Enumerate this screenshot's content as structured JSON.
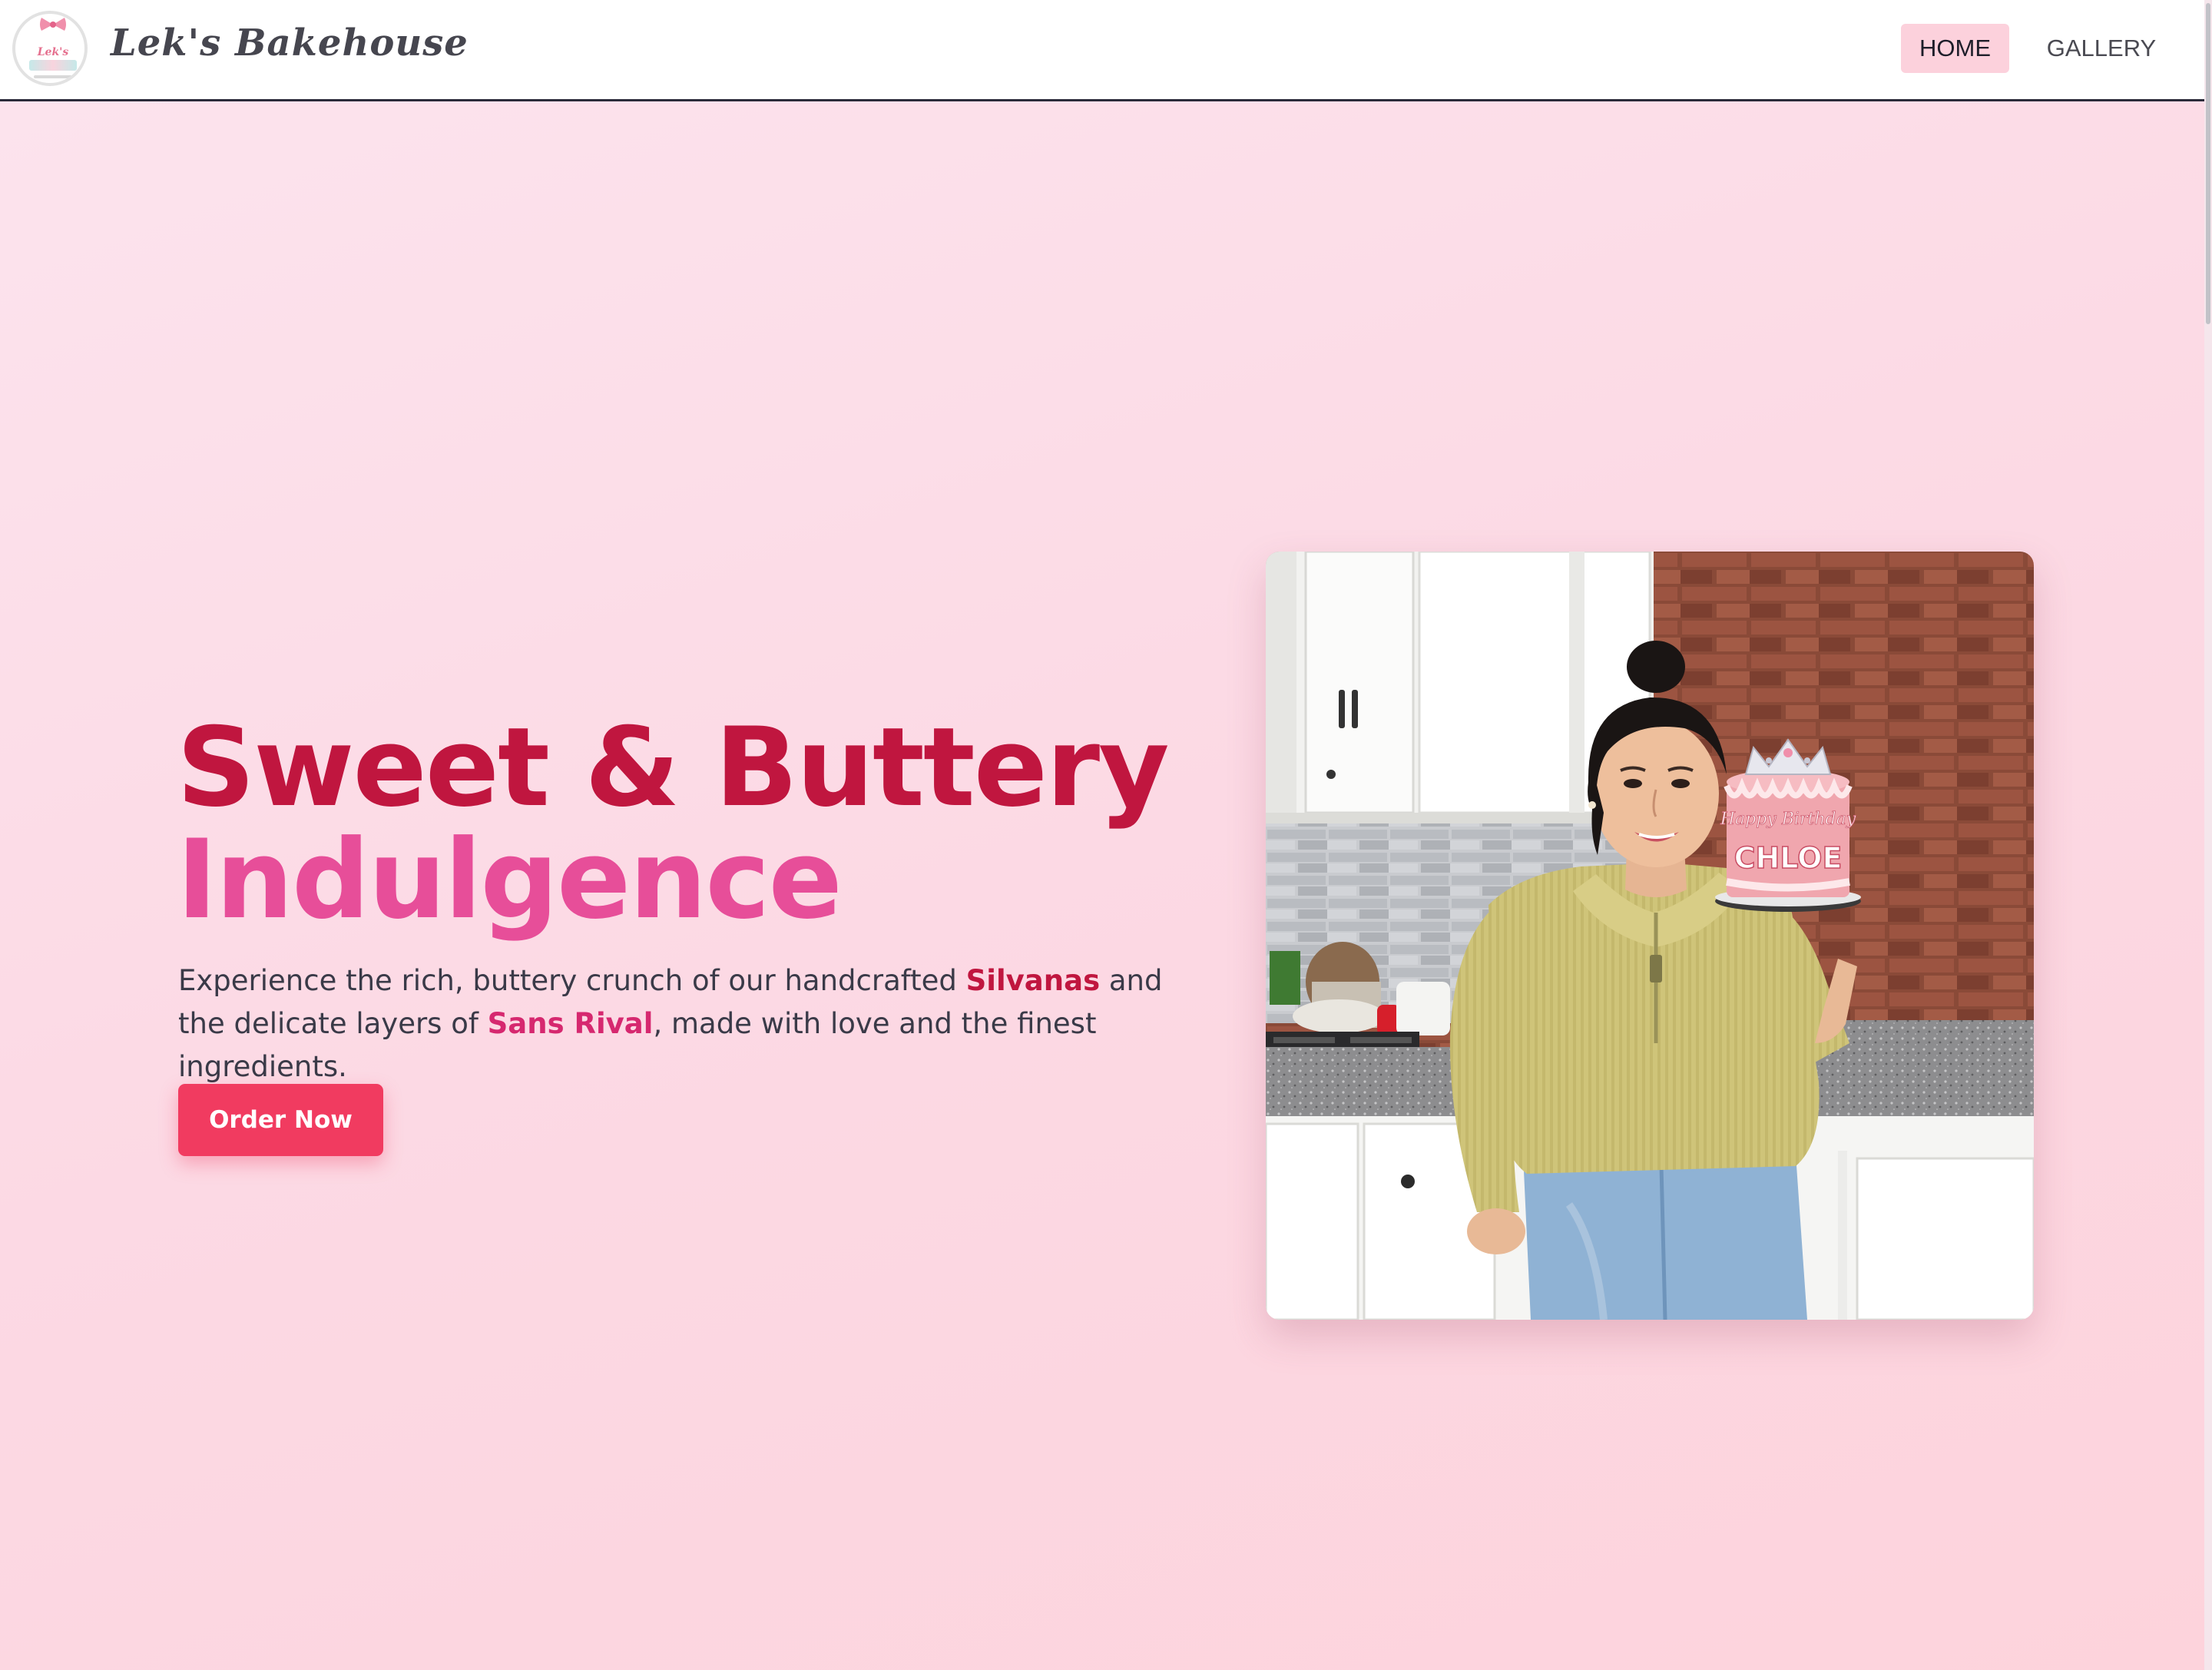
{
  "navbar": {
    "brand": "Lek's Bakehouse",
    "logo_text": "Lek's",
    "home_label": "HOME",
    "gallery_label": "GALLERY"
  },
  "hero": {
    "headline_line1": "Sweet & Buttery",
    "headline_line2": "Indulgence",
    "intro_part1": "Experience the rich, buttery crunch of our handcrafted ",
    "intro_highlight1": "Silvanas",
    "intro_part2": " and the delicate layers of ",
    "intro_highlight2": "Sans Rival",
    "intro_part3": ", made with love and the finest ingredients.",
    "cta_label": "Order Now"
  },
  "photo": {
    "cake_text_top": "Happy Birthday",
    "cake_text_name": "CHLOE"
  },
  "colors": {
    "primary_red": "#c0163f",
    "accent_pink": "#e74e99",
    "button": "#f13b60",
    "nav_active_bg": "#fcd1dc"
  },
  "icons": {
    "logo": "bakery-logo-icon",
    "bow": "bow-icon"
  }
}
